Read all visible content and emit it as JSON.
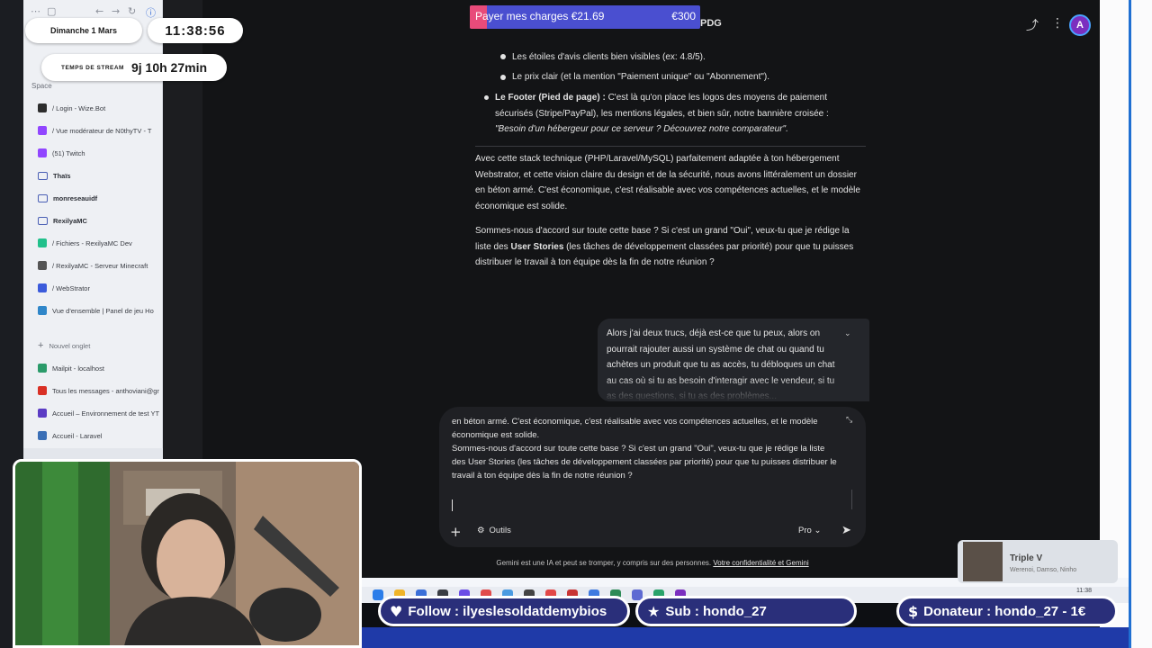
{
  "browser_sidebar": {
    "space_label": "Space",
    "items": [
      {
        "label": "/ Login - Wize.Bot",
        "color": "#2d2d2d",
        "type": "tab"
      },
      {
        "label": "/ Vue modérateur de N0thyTV - T",
        "color": "#9146ff",
        "type": "tab"
      },
      {
        "label": "(51) Twitch",
        "color": "#9146ff",
        "type": "tab"
      },
      {
        "label": "Thaïs",
        "type": "folder"
      },
      {
        "label": "monreseauidf",
        "type": "folder"
      },
      {
        "label": "RexilyaMC",
        "type": "folder"
      },
      {
        "label": "/ Fichiers - RexilyaMC Dev",
        "color": "#21c08b",
        "type": "tab"
      },
      {
        "label": "/ RexilyaMC - Serveur Minecraft",
        "color": "#555555",
        "type": "tab"
      },
      {
        "label": "/ WebStrator",
        "color": "#3b5bdb",
        "type": "tab"
      },
      {
        "label": "Vue d'ensemble | Panel de jeu Ho",
        "color": "#2f86c9",
        "type": "tab"
      },
      {
        "label": "Nouvel onglet",
        "type": "new"
      },
      {
        "label": "Mailpit - localhost",
        "color": "#2b9b6a",
        "type": "tab"
      },
      {
        "label": "Tous les messages - anthoviani@gm",
        "color": "#d93025",
        "type": "tab"
      },
      {
        "label": "Accueil – Environnement de test YT",
        "color": "#5b3cc4",
        "type": "tab"
      },
      {
        "label": "Accueil - Laravel",
        "color": "#3b6fb6",
        "type": "tab"
      }
    ]
  },
  "gemini": {
    "top_title": "PDG",
    "response": {
      "bullet_stars": "Les étoiles d'avis clients bien visibles (ex: 4.8/5).",
      "bullet_price": "Le prix clair (et la mention \"Paiement unique\" ou \"Abonnement\").",
      "footer_label": "Le Footer (Pied de page) :",
      "footer_text": " C'est là qu'on place les logos des moyens de paiement sécurisés (Stripe/PayPal), les mentions légales, et bien sûr, notre bannière croisée :",
      "footer_quote": "\"Besoin d'un hébergeur pour ce serveur ? Découvrez notre comparateur\".",
      "para1": "Avec cette stack technique (PHP/Laravel/MySQL) parfaitement adaptée à ton hébergement Webstrator, et cette vision claire du design et de la sécurité, nous avons littéralement un dossier en béton armé. C'est économique, c'est réalisable avec vos compétences actuelles, et le modèle économique est solide.",
      "para2_a": "Sommes-nous d'accord sur toute cette base ? Si c'est un grand \"Oui\", veux-tu que je rédige la liste des ",
      "para2_b": "User Stories",
      "para2_c": " (les tâches de développement classées par priorité) pour que tu puisses distribuer le travail à ton équipe dès la fin de notre réunion ?"
    },
    "user_message": "Alors j'ai deux trucs, déjà est-ce que tu peux, alors on pourrait rajouter aussi un système de chat ou quand tu achètes un produit que tu as accès, tu débloques un chat au cas où si tu as besoin d'interagir avec le vendeur, si tu as des questions, si tu as des problèmes...",
    "composer": {
      "line1": "en béton armé. C'est économique, c'est réalisable avec vos compétences actuelles, et le modèle économique est solide.",
      "line2": "Sommes-nous d'accord sur toute cette base ? Si c'est un grand \"Oui\", veux-tu que je rédige la liste des User Stories (les tâches de développement classées par priorité) pour que tu puisses distribuer le travail à ton équipe dès la fin de notre réunion ?",
      "tools_label": "Outils",
      "model_label": "Pro"
    },
    "disclaimer": "Gemini est une IA et peut se tromper, y compris sur des personnes.",
    "disclaimer_link": "Votre confidentialité et Gemini",
    "avatar_letter": "A"
  },
  "overlay": {
    "date": "Dimanche 1 Mars",
    "clock": "11:38:56",
    "stream_label": "TEMPS DE STREAM",
    "stream_time": "9j 10h 27min",
    "charges_label": "Payer mes charges €21.69",
    "charges_goal": "€300",
    "charges_progress": 0.0723,
    "follow": "Follow : ilyeslesoldatdemybios",
    "sub": "Sub : hondo_27",
    "donor": "Donateur : hondo_27 - 1€",
    "music_title": "Triple V",
    "music_artists": "Werenoi, Damso, Ninho"
  },
  "taskbar": {
    "clock": "11:38"
  }
}
